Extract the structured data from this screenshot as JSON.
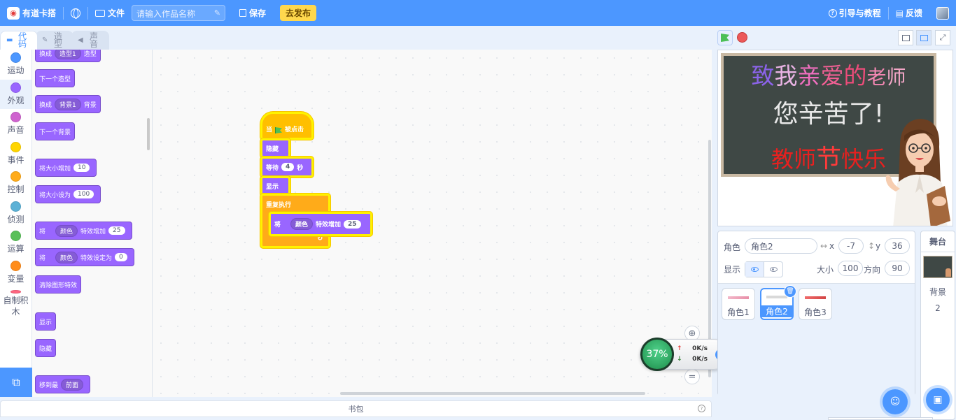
{
  "topbar": {
    "brand": "有道卡搭",
    "file_menu": "文件",
    "title_placeholder": "请输入作品名称",
    "save": "保存",
    "publish": "去发布",
    "guide": "引导与教程",
    "feedback": "反馈",
    "logo_glyph": "◉",
    "pen_glyph": "✎",
    "help_glyph": "?",
    "feedback_glyph": "▤"
  },
  "tabs": [
    {
      "label": "代码"
    },
    {
      "label": "造型"
    },
    {
      "label": "声音"
    }
  ],
  "categories": [
    {
      "label": "运动",
      "color": "#4c97ff"
    },
    {
      "label": "外观",
      "color": "#9966ff"
    },
    {
      "label": "声音",
      "color": "#cf63cf"
    },
    {
      "label": "事件",
      "color": "#ffd500"
    },
    {
      "label": "控制",
      "color": "#ffab19"
    },
    {
      "label": "侦测",
      "color": "#5cb1d6"
    },
    {
      "label": "运算",
      "color": "#59c059"
    },
    {
      "label": "变量",
      "color": "#ff8c1a"
    },
    {
      "label": "自制积木",
      "color": "#ff6680"
    }
  ],
  "palette": {
    "switch_costume": {
      "pre": "换成",
      "dd": "造型1",
      "post": "造型"
    },
    "next_costume": "下一个造型",
    "switch_backdrop": {
      "pre": "换成",
      "dd": "背景1",
      "post": "背景"
    },
    "next_backdrop": "下一个背景",
    "change_size": {
      "pre": "将大小增加",
      "val": "10"
    },
    "set_size": {
      "pre": "将大小设为",
      "val": "100"
    },
    "change_effect": {
      "pre": "将",
      "dd": "颜色",
      "mid": "特效增加",
      "val": "25"
    },
    "set_effect": {
      "pre": "将",
      "dd": "颜色",
      "mid": "特效设定为",
      "val": "0"
    },
    "clear_effects": "清除图形特效",
    "show": "显示",
    "hide": "隐藏",
    "go_to_layer": {
      "pre": "移到最",
      "dd": "前面"
    }
  },
  "script": {
    "when_flag": {
      "pre": "当",
      "post": "被点击"
    },
    "hide": "隐藏",
    "wait": {
      "pre": "等待",
      "val": "4",
      "post": "秒"
    },
    "show": "显示",
    "forever": "重复执行",
    "change_effect": {
      "pre": "将",
      "dd": "颜色",
      "mid": "特效增加",
      "val": "25"
    }
  },
  "network": {
    "percent": "37%",
    "upload": "0K/s",
    "download": "0K/s",
    "up_arrow": "↑",
    "down_arrow": "↓"
  },
  "backpack": {
    "label": "书包"
  },
  "stage": {
    "line1_a": "致",
    "line1_b": "我",
    "line1_c": "亲",
    "line1_d": "爱",
    "line1_e": "的",
    "line1_f": "老",
    "line1_g": "师",
    "line2": "您辛苦了!",
    "line3_a": "教师",
    "line3_b": "节",
    "line3_c": "快乐"
  },
  "sprite_info": {
    "sprite_label": "角色",
    "sprite_name": "角色2",
    "x_label": "x",
    "x_value": "-7",
    "y_label": "y",
    "y_value": "36",
    "show_label": "显示",
    "size_label": "大小",
    "size_value": "100",
    "direction_label": "方向",
    "direction_value": "90"
  },
  "sprites": [
    {
      "name": "角色1"
    },
    {
      "name": "角色2"
    },
    {
      "name": "角色3"
    }
  ],
  "stage_panel": {
    "title": "舞台",
    "backdrop_label": "背景",
    "backdrop_count": "2"
  }
}
